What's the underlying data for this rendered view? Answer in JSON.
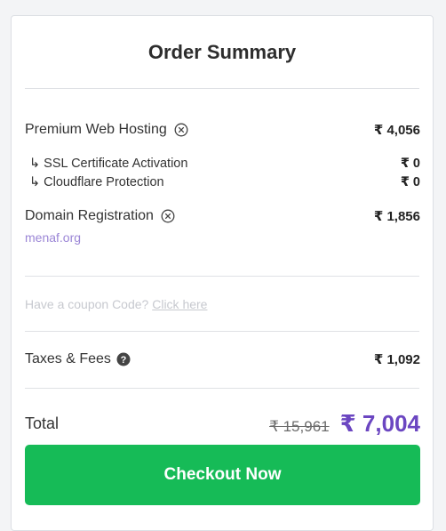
{
  "summary": {
    "title": "Order Summary",
    "items": {
      "hosting": {
        "label": "Premium Web Hosting",
        "price": "₹ 4,056"
      },
      "ssl": {
        "label": "↳ SSL Certificate Activation",
        "price": "₹ 0"
      },
      "cloudflare": {
        "label": "↳ Cloudflare Protection",
        "price": "₹ 0"
      },
      "domain": {
        "label": "Domain Registration",
        "price": "₹ 1,856",
        "name": "menaf.org"
      }
    },
    "coupon": {
      "prompt": "Have a coupon Code?",
      "link": "Click here"
    },
    "taxes": {
      "label": "Taxes & Fees",
      "price": "₹ 1,092"
    },
    "total": {
      "label": "Total",
      "old_price": "₹ 15,961",
      "new_price": "₹ 7,004"
    },
    "checkout_label": "Checkout Now"
  },
  "colors": {
    "accent_purple": "#6b46c1",
    "checkout_green": "#16bb57",
    "domain_link": "#9b86d6"
  },
  "icons": {
    "remove": "circle-x-icon",
    "help": "question-circle-icon"
  }
}
